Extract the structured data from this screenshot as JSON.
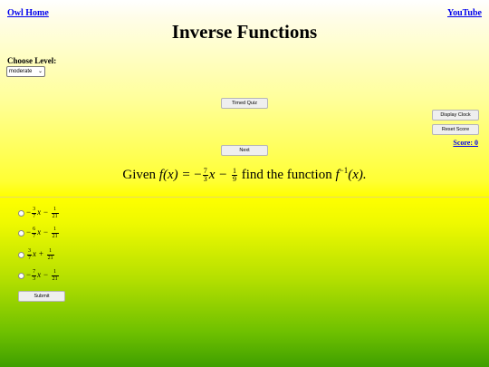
{
  "nav": {
    "home": "Owl Home",
    "youtube": "YouTube"
  },
  "title": "Inverse Functions",
  "level": {
    "label": "Choose Level:",
    "selected": "moderate"
  },
  "buttons": {
    "timed_quiz": "Timed Quiz",
    "display_clock": "Display Clock",
    "reset_score": "Reset Score",
    "next": "Next",
    "submit": "Submit"
  },
  "score": "Score: 0",
  "question": {
    "prefix": "Given",
    "fx": "f(x) =",
    "sign": "−",
    "a_num": "7",
    "a_den": "3",
    "x_minus": "x −",
    "b_num": "1",
    "b_den": "9",
    "middle": "find the function",
    "finv": "f",
    "finv_exp": "−1",
    "finv_arg": "(x)."
  },
  "options": [
    {
      "sign": "−",
      "a_num": "3",
      "a_den": "7",
      "op": "x −",
      "b_num": "1",
      "b_den": "21"
    },
    {
      "sign": "−",
      "a_num": "6",
      "a_den": "7",
      "op": "x −",
      "b_num": "1",
      "b_den": "21"
    },
    {
      "sign": "",
      "a_num": "3",
      "a_den": "7",
      "op": "x +",
      "b_num": "1",
      "b_den": "21"
    },
    {
      "sign": "−",
      "a_num": "7",
      "a_den": "3",
      "op": "x −",
      "b_num": "1",
      "b_den": "21"
    }
  ],
  "colors": {
    "link": "#0000ee",
    "top_bg": "#ffff00",
    "bottom_bg": "#3f9f00"
  }
}
